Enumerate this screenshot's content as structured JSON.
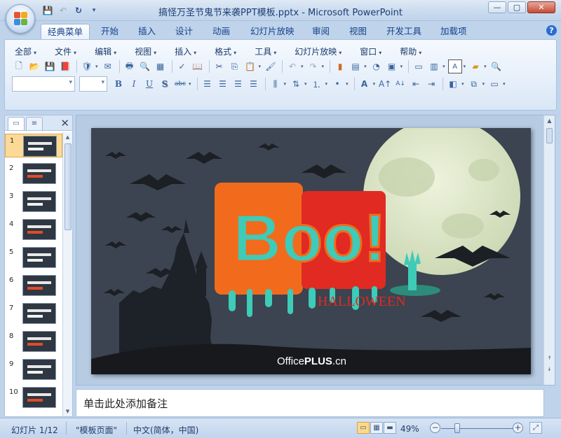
{
  "window": {
    "title": "搞怪万圣节鬼节来袭PPT模板.pptx - Microsoft PowerPoint",
    "controls": [
      "—",
      "▢",
      "✕"
    ]
  },
  "quick_access": {
    "icons": [
      "save-icon",
      "undo-icon",
      "redo-icon",
      "customize-icon"
    ]
  },
  "ribbon_tabs": [
    {
      "label": "经典菜单",
      "active": true
    },
    {
      "label": "开始"
    },
    {
      "label": "插入"
    },
    {
      "label": "设计"
    },
    {
      "label": "动画"
    },
    {
      "label": "幻灯片放映"
    },
    {
      "label": "审阅"
    },
    {
      "label": "视图"
    },
    {
      "label": "开发工具"
    },
    {
      "label": "加载项"
    }
  ],
  "menus": [
    "全部",
    "文件",
    "编辑",
    "视图",
    "插入",
    "格式",
    "工具",
    "幻灯片放映",
    "窗口",
    "帮助"
  ],
  "format_buttons": {
    "bold": "B",
    "italic": "I",
    "underline": "U",
    "shadow": "S",
    "strike": "abc"
  },
  "slides_pane": {
    "slide_numbers": [
      "1",
      "2",
      "3",
      "4",
      "5",
      "6",
      "7",
      "8",
      "9",
      "10"
    ],
    "selected_index": 0
  },
  "slide": {
    "boo_text": "Boo!",
    "subtitle": "HALLOWEEN",
    "brand_regular": "Office",
    "brand_bold": "PLUS",
    "brand_suffix": ".cn",
    "colors": {
      "background": "#3b4450",
      "orange": "#f26b1d",
      "teal": "#3ecbb8",
      "red": "#e02a22",
      "moon": "#e2ebd0"
    }
  },
  "notes": {
    "placeholder": "单击此处添加备注"
  },
  "status": {
    "slide_counter": "幻灯片 1/12",
    "theme": "\"模板页面\"",
    "language": "中文(简体，中国)",
    "zoom": "49%",
    "zoom_fraction": 0.2
  }
}
